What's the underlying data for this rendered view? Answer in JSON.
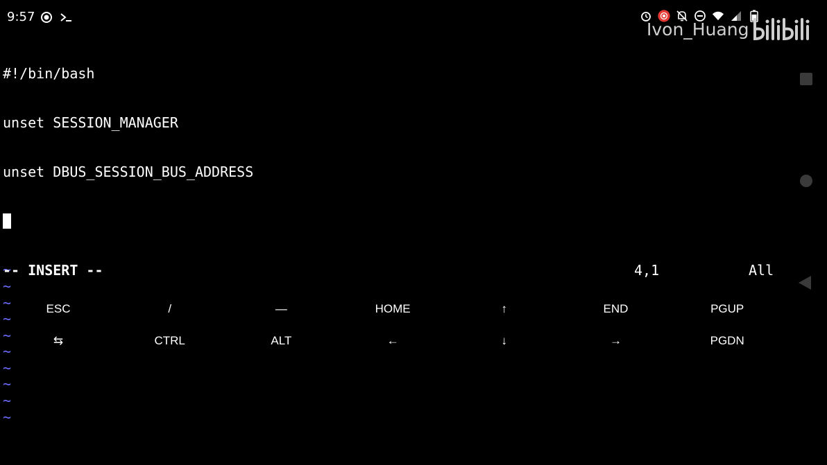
{
  "status_bar": {
    "time": "9:57",
    "left_icons": [
      "screen-record-icon",
      "terminal-icon"
    ],
    "right_icons": [
      "alarm-icon",
      "recording-badge-icon",
      "bell-off-icon",
      "do-not-disturb-icon",
      "wifi-icon",
      "signal-icon",
      "battery-icon"
    ],
    "recording_color": "#e53935"
  },
  "watermark": {
    "user": "Ivon_Huang",
    "logo": "bilibili"
  },
  "terminal": {
    "lines": [
      "#!/bin/bash",
      "unset SESSION_MANAGER",
      "unset DBUS_SESSION_BUS_ADDRESS"
    ],
    "tilde": "~",
    "tilde_color": "#6b6bff",
    "empty_line_count": 10
  },
  "vim_status": {
    "mode": "-- INSERT --",
    "position": "4,1",
    "scroll": "All"
  },
  "extra_keys": {
    "row1": [
      "ESC",
      "/",
      "—",
      "HOME",
      "↑",
      "END",
      "PGUP"
    ],
    "row2": [
      "⇆",
      "CTRL",
      "ALT",
      "←",
      "↓",
      "→",
      "PGDN"
    ]
  },
  "nav_bar": {
    "icons": [
      "recents-icon",
      "home-icon",
      "back-icon"
    ]
  }
}
